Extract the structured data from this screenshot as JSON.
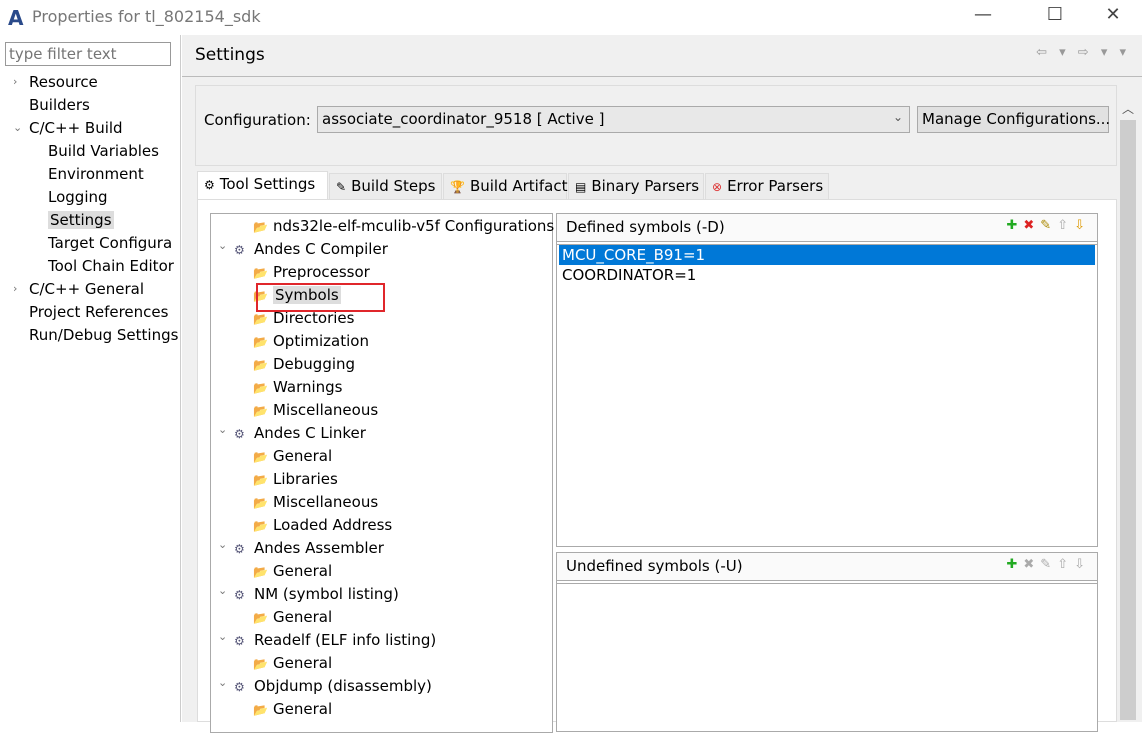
{
  "window": {
    "title": "Properties for tl_802154_sdk",
    "logo": "A",
    "minimize": "—",
    "maximize": "☐",
    "close": "✕"
  },
  "filter": {
    "placeholder": "type filter text"
  },
  "nav": [
    {
      "label": "Resource",
      "level": 0,
      "chevron": "›"
    },
    {
      "label": "Builders",
      "level": 0
    },
    {
      "label": "C/C++ Build",
      "level": 0,
      "chevron": "⌄"
    },
    {
      "label": "Build Variables",
      "level": 1
    },
    {
      "label": "Environment",
      "level": 1
    },
    {
      "label": "Logging",
      "level": 1
    },
    {
      "label": "Settings",
      "level": 1,
      "selected": true
    },
    {
      "label": "Target Configura",
      "level": 1
    },
    {
      "label": "Tool Chain Editor",
      "level": 1
    },
    {
      "label": "C/C++ General",
      "level": 0,
      "chevron": "›"
    },
    {
      "label": "Project References",
      "level": 0
    },
    {
      "label": "Run/Debug Settings",
      "level": 0
    }
  ],
  "header": {
    "title": "Settings",
    "nav_icons": "⇦ ▾ ⇨ ▾ ▾"
  },
  "configuration": {
    "label": "Configuration:",
    "value": "associate_coordinator_9518  [ Active ]",
    "manage_label": "Manage Configurations..."
  },
  "tabs": [
    {
      "label": "Tool Settings",
      "icon": "gear-icon",
      "glyph": "⚙",
      "active": true
    },
    {
      "label": "Build Steps",
      "icon": "hammer-icon",
      "glyph": "✎"
    },
    {
      "label": "Build Artifact",
      "icon": "trophy-icon",
      "glyph": "🏆"
    },
    {
      "label": "Binary Parsers",
      "icon": "binary-icon",
      "glyph": "▤"
    },
    {
      "label": "Error Parsers",
      "icon": "error-icon",
      "glyph": "⊗"
    }
  ],
  "tool_tree": [
    {
      "label": "nds32le-elf-mculib-v5f Configurations",
      "level": 1,
      "icon": "folder-gear-icon"
    },
    {
      "label": "Andes C Compiler",
      "level": 0,
      "icon": "gear-icon",
      "expanded": true
    },
    {
      "label": "Preprocessor",
      "level": 1,
      "icon": "folder-gear-icon"
    },
    {
      "label": "Symbols",
      "level": 1,
      "icon": "folder-gear-icon",
      "selected": true
    },
    {
      "label": "Directories",
      "level": 1,
      "icon": "folder-gear-icon"
    },
    {
      "label": "Optimization",
      "level": 1,
      "icon": "folder-gear-icon"
    },
    {
      "label": "Debugging",
      "level": 1,
      "icon": "folder-gear-icon"
    },
    {
      "label": "Warnings",
      "level": 1,
      "icon": "folder-gear-icon"
    },
    {
      "label": "Miscellaneous",
      "level": 1,
      "icon": "folder-gear-icon"
    },
    {
      "label": "Andes C Linker",
      "level": 0,
      "icon": "gear-icon",
      "expanded": true
    },
    {
      "label": "General",
      "level": 1,
      "icon": "folder-gear-icon"
    },
    {
      "label": "Libraries",
      "level": 1,
      "icon": "folder-gear-icon"
    },
    {
      "label": "Miscellaneous",
      "level": 1,
      "icon": "folder-gear-icon"
    },
    {
      "label": "Loaded Address",
      "level": 1,
      "icon": "folder-gear-icon"
    },
    {
      "label": "Andes Assembler",
      "level": 0,
      "icon": "gear-icon",
      "expanded": true
    },
    {
      "label": "General",
      "level": 1,
      "icon": "folder-gear-icon"
    },
    {
      "label": "NM (symbol listing)",
      "level": 0,
      "icon": "gear-icon",
      "expanded": true
    },
    {
      "label": "General",
      "level": 1,
      "icon": "folder-gear-icon"
    },
    {
      "label": "Readelf (ELF info listing)",
      "level": 0,
      "icon": "gear-icon",
      "expanded": true
    },
    {
      "label": "General",
      "level": 1,
      "icon": "folder-gear-icon"
    },
    {
      "label": "Objdump (disassembly)",
      "level": 0,
      "icon": "gear-icon",
      "expanded": true
    },
    {
      "label": "General",
      "level": 1,
      "icon": "folder-gear-icon"
    }
  ],
  "defined": {
    "title": "Defined symbols (-D)",
    "items": [
      "MCU_CORE_B91=1",
      "COORDINATOR=1"
    ],
    "selected_index": 0
  },
  "undefined": {
    "title": "Undefined symbols (-U)",
    "items": []
  },
  "colors": {
    "selection": "#0078d7",
    "highlight_box": "#e0262b"
  }
}
